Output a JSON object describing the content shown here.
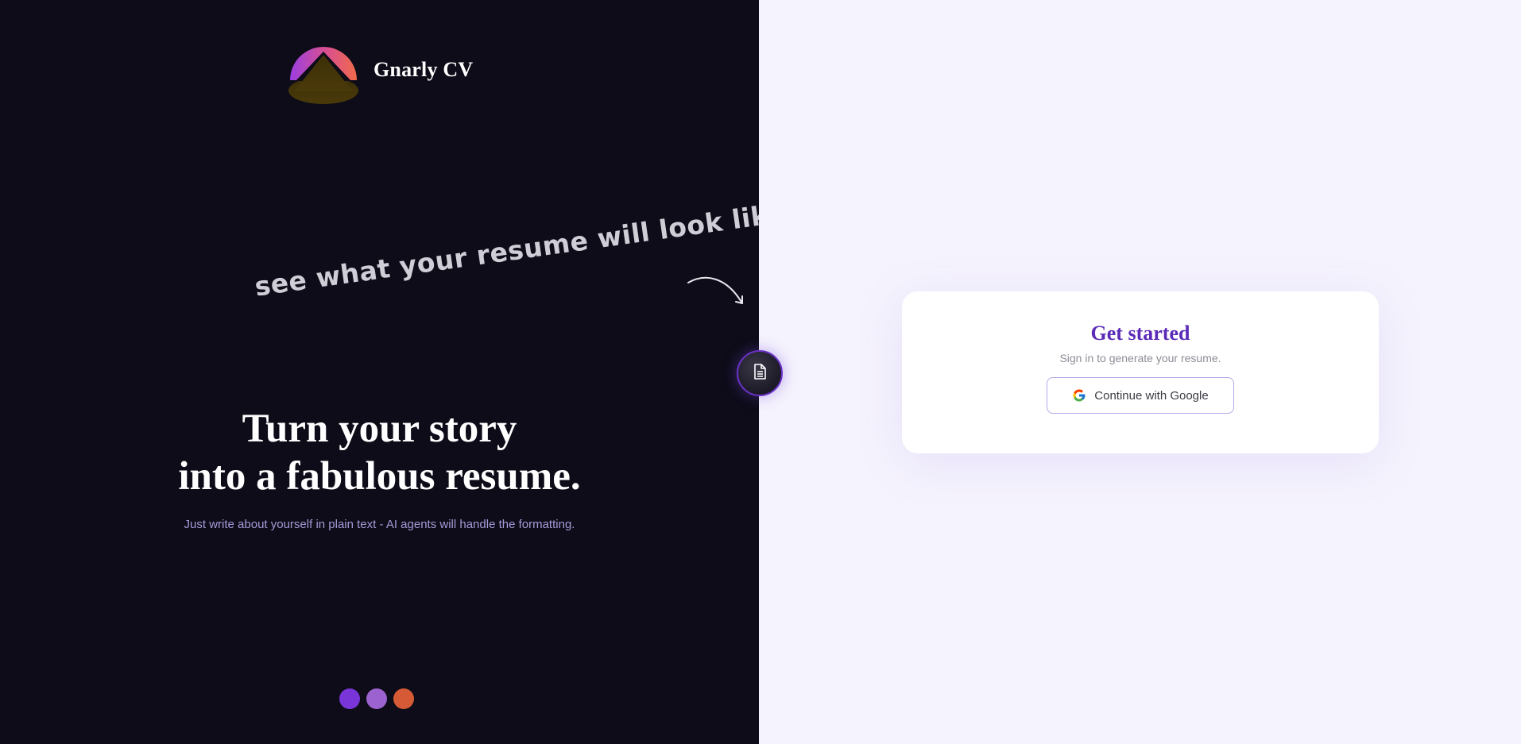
{
  "brand": {
    "name": "Gnarly CV",
    "logo_icon": "mountain-logo-icon"
  },
  "hero": {
    "handwritten_hint": "see what your resume will look like",
    "headline_line1": "Turn your story",
    "headline_line2": "into a fabulous resume.",
    "subtitle": "Just write about yourself in plain text - AI agents will handle the formatting."
  },
  "center_toggle": {
    "icon": "document-icon"
  },
  "dots": [
    {
      "color": "#7a35d9"
    },
    {
      "color": "#9c62cf"
    },
    {
      "color": "#d65a35"
    }
  ],
  "auth_card": {
    "title": "Get started",
    "subtitle": "Sign in to generate your resume.",
    "google_button_label": "Continue with Google",
    "google_icon": "google-icon"
  },
  "colors": {
    "left_bg": "#0d0c18",
    "right_bg": "#f5f3fd",
    "accent": "#5b2bb8"
  }
}
